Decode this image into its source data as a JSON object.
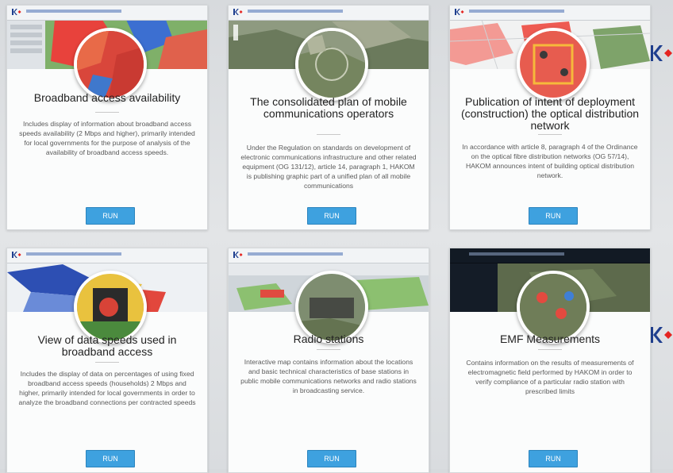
{
  "cards": [
    {
      "title": "Broadband access availability",
      "description": "Includes display of information about broadband access speeds availability (2 Mbps and higher), primarily intended for local governments for the purpose of analysis of the availability of broadband access speeds.",
      "button": "RUN"
    },
    {
      "title": "The consolidated plan of mobile communications operators",
      "description": "Under the Regulation on standards on development of electronic communications infrastructure and other related equipment (OG 131/12), article 14, paragraph 1, HAKOM is publishing graphic part of a unified plan of all mobile communications",
      "button": "RUN"
    },
    {
      "title": "Publication of intent of deployment (construction) the optical distribution network",
      "description": "In accordance with article 8, paragraph 4 of the Ordinance on the optical fibre distribution networks (OG 57/14), HAKOM announces intent of building optical distribution network.",
      "button": "RUN"
    },
    {
      "title": "View of data speeds used in broadband access",
      "description": "Includes the display of data on percentages of using fixed broadband access speeds (households) 2 Mbps and higher, primarily intended for local governments in order to analyze the broadband connections per contracted speeds",
      "button": "RUN"
    },
    {
      "title": "Radio stations",
      "description": "Interactive map contains information about the locations and basic technical characteristics of base stations in public mobile communications networks and radio stations in broadcasting service.",
      "button": "RUN"
    },
    {
      "title": "EMF Measurements",
      "description": "Contains information on the results of measurements of electromagnetic field performed by HAKOM in order to verify compliance of a particular radio station with prescribed limits",
      "button": "RUN"
    }
  ],
  "colors": {
    "button": "#3ea1df",
    "logo_blue": "#1f3f8f",
    "logo_red": "#e52521"
  },
  "icons": [
    "hakom-logo"
  ]
}
